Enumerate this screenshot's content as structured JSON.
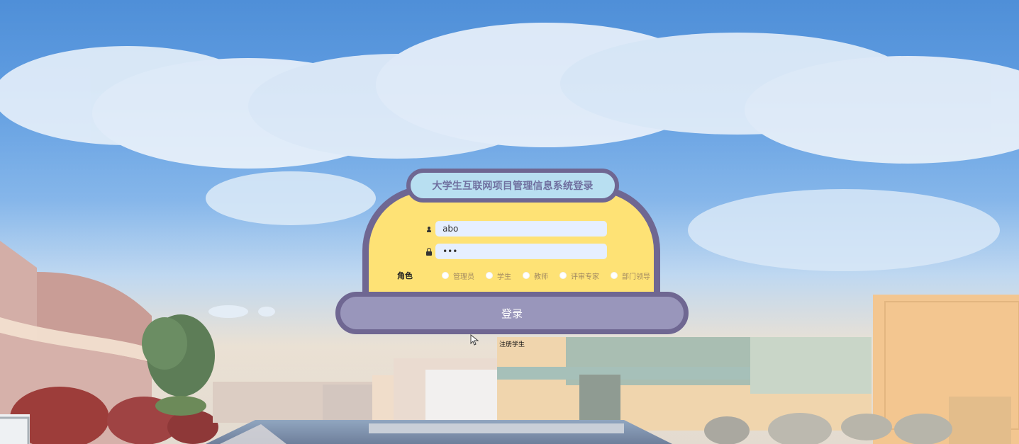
{
  "page": {
    "title": "大学生互联网项目管理信息系统登录",
    "login_button": "登录",
    "register_link": "注册学生"
  },
  "form": {
    "username": {
      "icon": "user-icon",
      "value": "abo"
    },
    "password": {
      "icon": "lock-icon",
      "value": "•••"
    },
    "role_label": "角色",
    "roles": [
      {
        "label": "管理员",
        "selected": false
      },
      {
        "label": "学生",
        "selected": false
      },
      {
        "label": "教师",
        "selected": false
      },
      {
        "label": "评审专家",
        "selected": false
      },
      {
        "label": "部门领导",
        "selected": false
      }
    ]
  },
  "colors": {
    "panel": "#fee275",
    "border": "#6f6792",
    "title_pill": "#b8dff1",
    "button": "#9996bb",
    "input": "#e6efff"
  }
}
